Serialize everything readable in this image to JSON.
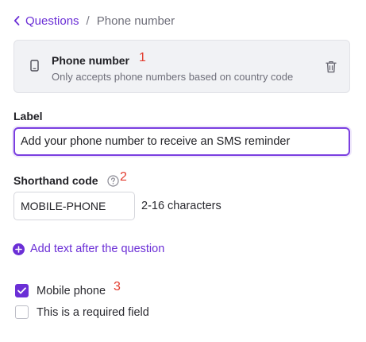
{
  "breadcrumb": {
    "back_label": "Questions",
    "separator": "/",
    "current": "Phone number"
  },
  "question_type": {
    "title": "Phone number",
    "description": "Only accepts phone numbers based on country code",
    "icon": "smartphone-icon",
    "delete_icon": "trash-icon"
  },
  "annotations": {
    "marker_1": "1",
    "marker_2": "2",
    "marker_3": "3"
  },
  "label_field": {
    "label": "Label",
    "value": "Add your phone number to receive an SMS reminder"
  },
  "shorthand": {
    "label": "Shorthand code",
    "help_icon": "question-circle-icon",
    "value": "MOBILE-PHONE",
    "hint": "2-16 characters"
  },
  "add_text": {
    "label": "Add text after the question",
    "icon": "plus-circle-icon"
  },
  "options": [
    {
      "label": "Mobile phone",
      "checked": true
    },
    {
      "label": "This is a required field",
      "checked": false
    }
  ],
  "colors": {
    "accent": "#6b2fd6",
    "marker": "#e23b2e",
    "card_bg": "#f1f2f5",
    "muted_text": "#6f6f7a"
  }
}
